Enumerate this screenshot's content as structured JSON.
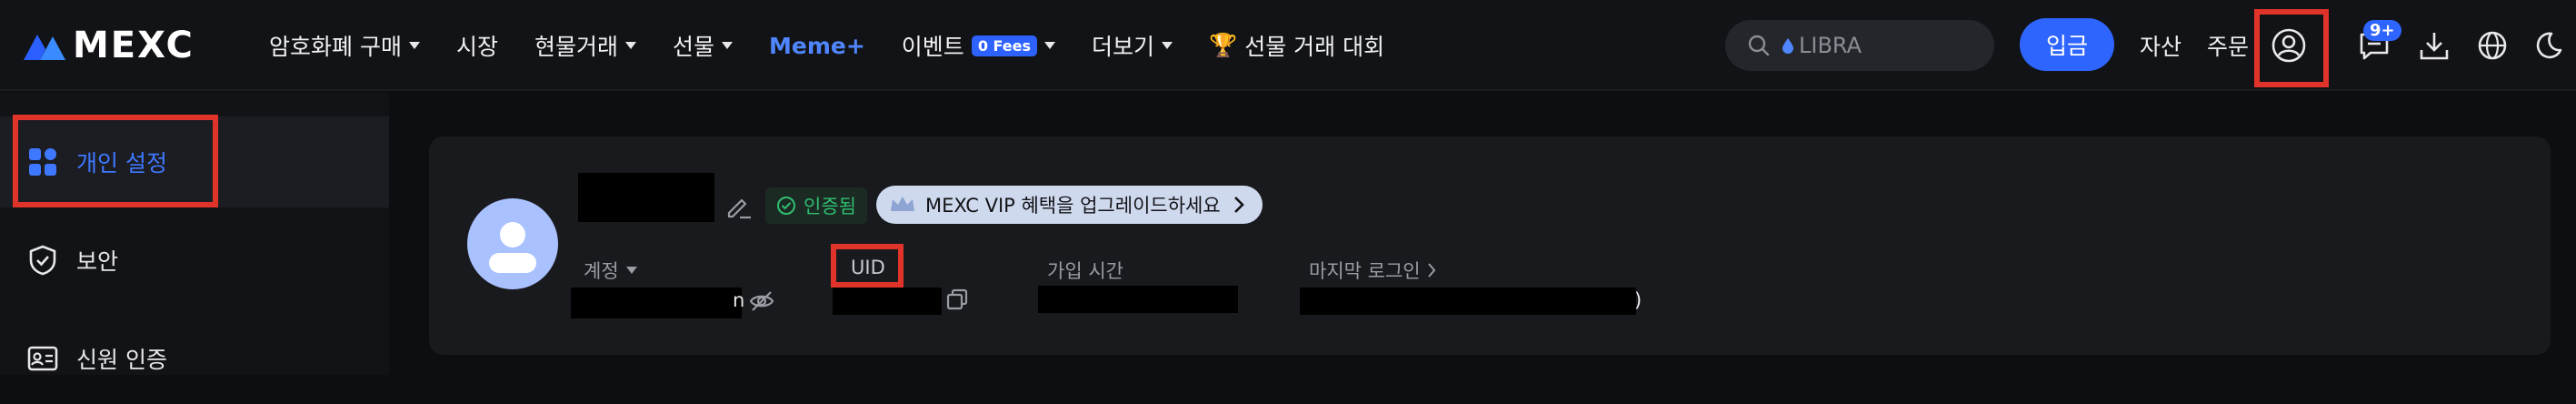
{
  "brand": {
    "name": "MEXC"
  },
  "nav": {
    "items": [
      {
        "label": "암호화폐 구매",
        "has_caret": true
      },
      {
        "label": "시장",
        "has_caret": false
      },
      {
        "label": "현물거래",
        "has_caret": true
      },
      {
        "label": "선물",
        "has_caret": true
      },
      {
        "label": "Meme+",
        "has_caret": false
      },
      {
        "label": "이벤트",
        "badge": "0 Fees",
        "has_caret": true
      },
      {
        "label": "더보기",
        "has_caret": true
      },
      {
        "label": "선물 거래 대회",
        "icon": "trophy-icon"
      }
    ]
  },
  "search": {
    "placeholder": "LIBRA"
  },
  "header": {
    "deposit_label": "입금",
    "assets_label": "자산",
    "orders_label": "주문",
    "notification_count": "9+"
  },
  "sidebar": {
    "items": [
      {
        "label": "개인 설정",
        "icon": "dashboard-icon",
        "active": true
      },
      {
        "label": "보안",
        "icon": "shield-check-icon",
        "active": false
      },
      {
        "label": "신원 인증",
        "icon": "id-card-icon",
        "active": false
      }
    ]
  },
  "profile": {
    "verified_label": "인증됨",
    "vip_banner": "MEXC VIP 혜택을 업그레이드하세요",
    "fields": {
      "account_label": "계정",
      "account_suffix": "n",
      "uid_label": "UID",
      "join_time_label": "가입 시간",
      "last_login_label": "마지막 로그인",
      "last_login_suffix": ")"
    }
  },
  "colors": {
    "accent": "#2f65ff",
    "highlight_box": "#e0342a",
    "verified": "#2fbf71",
    "background": "#0d0e11"
  }
}
